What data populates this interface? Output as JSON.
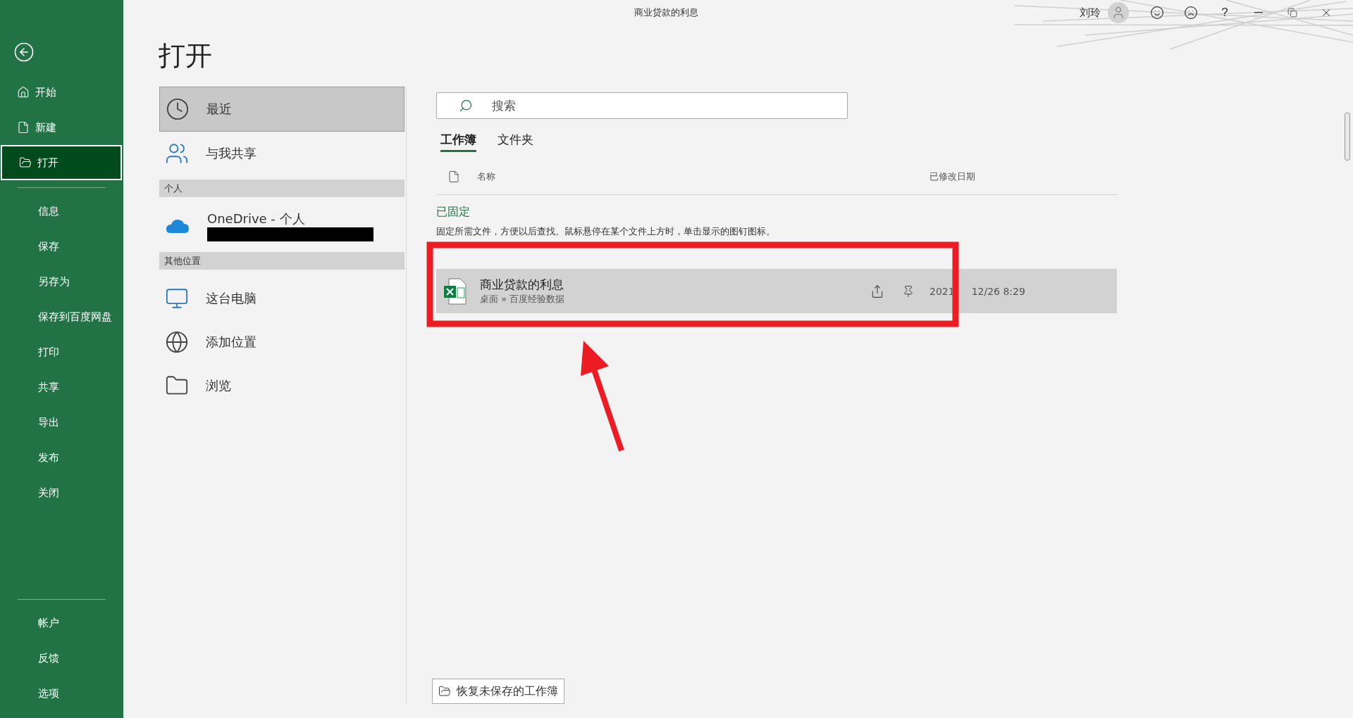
{
  "window": {
    "title": "商业贷款的利息",
    "user": "刘玲",
    "help": "?"
  },
  "sidebar": {
    "items": [
      {
        "label": "开始",
        "selected": false
      },
      {
        "label": "新建",
        "selected": false
      },
      {
        "label": "打开",
        "selected": true
      },
      {
        "label": "信息",
        "selected": false
      },
      {
        "label": "保存",
        "selected": false
      },
      {
        "label": "另存为",
        "selected": false
      },
      {
        "label": "保存到百度网盘",
        "selected": false
      },
      {
        "label": "打印",
        "selected": false
      },
      {
        "label": "共享",
        "selected": false
      },
      {
        "label": "导出",
        "selected": false
      },
      {
        "label": "发布",
        "selected": false
      },
      {
        "label": "关闭",
        "selected": false
      }
    ],
    "bottom_items": [
      {
        "label": "帐户",
        "selected": false
      },
      {
        "label": "反馈",
        "selected": false
      },
      {
        "label": "选项",
        "selected": false
      }
    ]
  },
  "page_title": "打开",
  "locations": [
    {
      "kind": "recent",
      "label": "最近",
      "selected": true
    },
    {
      "kind": "shared",
      "label": "与我共享",
      "selected": false
    },
    {
      "kind": "header",
      "label": "个人"
    },
    {
      "kind": "onedrive",
      "label": "OneDrive - 个人",
      "selected": false
    },
    {
      "kind": "header",
      "label": "其他位置"
    },
    {
      "kind": "pc",
      "label": "这台电脑",
      "selected": false
    },
    {
      "kind": "add",
      "label": "添加位置",
      "selected": false
    },
    {
      "kind": "browse",
      "label": "浏览",
      "selected": false
    }
  ],
  "search": {
    "placeholder": "搜索"
  },
  "tabs": [
    {
      "label": "工作簿",
      "selected": true
    },
    {
      "label": "文件夹",
      "selected": false
    }
  ],
  "columns": [
    "名称",
    "已修改日期"
  ],
  "pinned": {
    "title": "已固定",
    "hint": "固定所需文件，方便以后查找。鼠标悬停在某个文件上方时，单击显示的图钉图标。"
  },
  "groups": [
    {
      "files": [
        {
          "name": "商业贷款的利息",
          "path": "桌面 » 百度经验数据",
          "modified_start": "2021",
          "modified_end": "12/26 8:29",
          "highlighted": true
        }
      ]
    }
  ],
  "recover_button": "恢复未保存的工作簿"
}
